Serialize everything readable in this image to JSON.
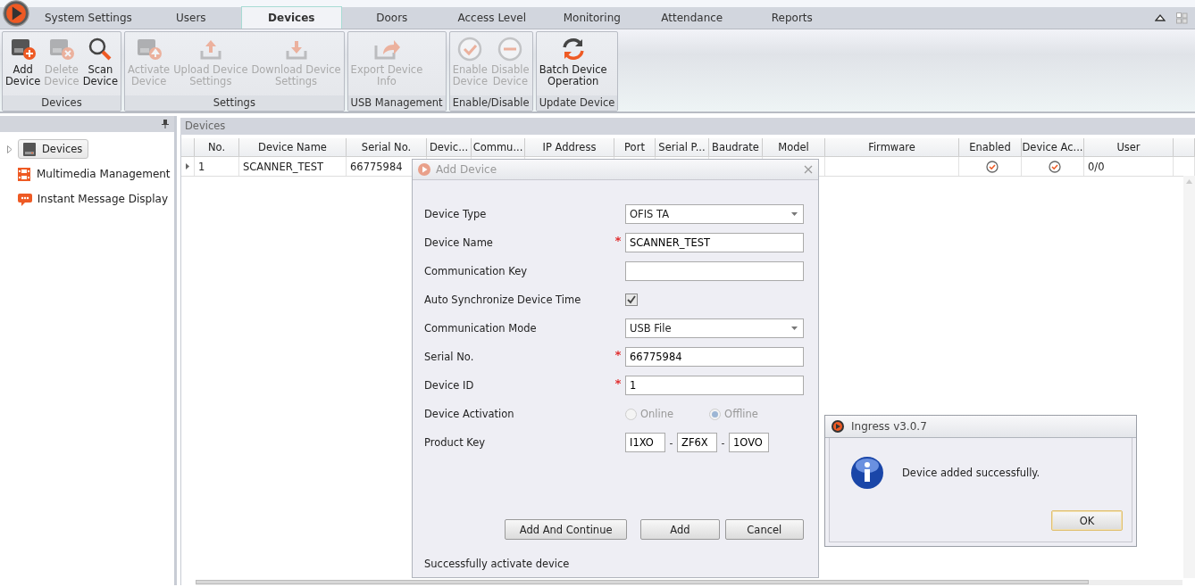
{
  "tabs": [
    {
      "label": "System Settings",
      "selected": false
    },
    {
      "label": "Users",
      "selected": false
    },
    {
      "label": "Devices",
      "selected": true
    },
    {
      "label": "Doors",
      "selected": false
    },
    {
      "label": "Access Level",
      "selected": false
    },
    {
      "label": "Monitoring",
      "selected": false
    },
    {
      "label": "Attendance",
      "selected": false
    },
    {
      "label": "Reports",
      "selected": false
    }
  ],
  "ribbon_groups": [
    {
      "label": "Devices",
      "buttons": [
        {
          "label": "Add\nDevice",
          "disabled": false
        },
        {
          "label": "Delete\nDevice",
          "disabled": true
        },
        {
          "label": "Scan\nDevice",
          "disabled": false
        }
      ]
    },
    {
      "label": "Settings",
      "buttons": [
        {
          "label": "Activate\nDevice",
          "disabled": true
        },
        {
          "label": "Upload Device\nSettings",
          "disabled": true
        },
        {
          "label": "Download Device\nSettings",
          "disabled": true
        }
      ]
    },
    {
      "label": "USB Management",
      "buttons": [
        {
          "label": "Export Device\nInfo",
          "disabled": true
        }
      ]
    },
    {
      "label": "Enable/Disable",
      "buttons": [
        {
          "label": "Enable\nDevice",
          "disabled": true
        },
        {
          "label": "Disable\nDevice",
          "disabled": true
        }
      ]
    },
    {
      "label": "Update Device",
      "buttons": [
        {
          "label": "Batch Device\nOperation",
          "disabled": false
        }
      ]
    }
  ],
  "sidebar": {
    "items": [
      {
        "label": "Devices",
        "selected": true,
        "expanded": false
      },
      {
        "label": "Multimedia Management",
        "selected": false
      },
      {
        "label": "Instant Message Display",
        "selected": false
      }
    ]
  },
  "panel": {
    "title": "Devices"
  },
  "table": {
    "columns": [
      "No.",
      "Device Name",
      "Serial No.",
      "Devic...",
      "Commu...",
      "IP Address",
      "Port",
      "Serial P...",
      "Baudrate",
      "Model",
      "Firmware",
      "Enabled",
      "Device Ac...",
      "User"
    ],
    "rows": [
      {
        "no": "1",
        "device_name": "SCANNER_TEST",
        "serial_no": "66775984",
        "enabled": true,
        "device_activated": true,
        "user": "0/0"
      }
    ]
  },
  "add_device_dialog": {
    "title": "Add Device",
    "fields": [
      {
        "kind": "select",
        "label": "Device Type",
        "required": false,
        "value": "OFIS TA"
      },
      {
        "kind": "text",
        "label": "Device Name",
        "required": true,
        "value": "SCANNER_TEST"
      },
      {
        "kind": "text",
        "label": "Communication Key",
        "required": false
      },
      {
        "kind": "checkbox",
        "label": "Auto Synchronize Device Time",
        "required": false,
        "checked": true
      },
      {
        "kind": "select",
        "label": "Communication Mode",
        "required": false,
        "value": "USB File"
      },
      {
        "kind": "text",
        "label": "Serial No.",
        "required": true,
        "value": "66775984"
      },
      {
        "kind": "text",
        "label": "Device ID",
        "required": true,
        "value": "1"
      },
      {
        "kind": "radio",
        "label": "Device Activation",
        "required": false,
        "disabled": true,
        "options": [
          {
            "label": "Online",
            "selected": false
          },
          {
            "label": "Offline",
            "selected": true
          }
        ]
      },
      {
        "kind": "key",
        "label": "Product Key",
        "required": false,
        "parts": [
          "I1XO",
          "ZF6X",
          "1OVO"
        ],
        "separators": [
          "-",
          "-"
        ]
      }
    ],
    "buttons": [
      "Add And Continue",
      "Add",
      "Cancel"
    ],
    "status": "Successfully activate device"
  },
  "message_box": {
    "title": "Ingress v3.0.7",
    "message": "Device added successfully.",
    "button": "OK"
  }
}
